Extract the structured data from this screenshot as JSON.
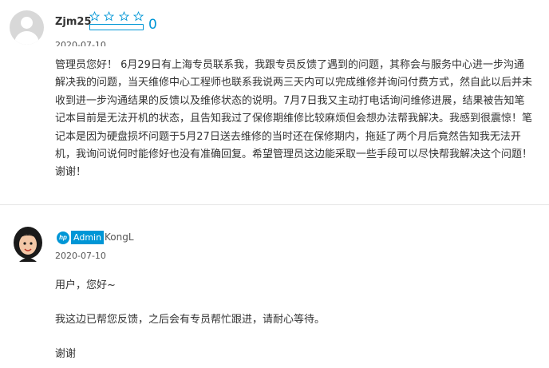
{
  "post": {
    "username": "Zjm25",
    "kudos_count": "0",
    "date": "2020-07-10",
    "rating_stars": 0,
    "body": "管理员您好！ 6月29日有上海专员联系我，我跟专员反馈了遇到的问题，其称会与服务中心进一步沟通解决我的问题，当天维修中心工程师也联系我说两三天内可以完成维修并询问付费方式，然自此以后并未收到进一步沟通结果的反馈以及维修状态的说明。7月7日我又主动打电话询问维修进展，结果被告知笔记本目前是无法开机的状态，且告知我过了保修期维修比较麻烦但会想办法帮我解决。我感到很震惊！笔记本是因为硬盘损坏问题于5月27日送去维修的当时还在保修期内，拖延了两个月后竟然告知我无法开机，我询问说何时能修好也没有准确回复。希望管理员这边能采取一些手段可以尽快帮我解决这个问题！谢谢！"
  },
  "reply": {
    "logo_text": "hp",
    "badge": "Admin",
    "username": "KongL",
    "date": "2020-07-10",
    "greeting": "用户，您好~",
    "message": "我这边已帮您反馈，之后会有专员帮忙跟进，请耐心等待。",
    "closing": "谢谢"
  },
  "colors": {
    "accent": "#0096d6",
    "text": "#333333",
    "divider": "#e5e5e5"
  }
}
